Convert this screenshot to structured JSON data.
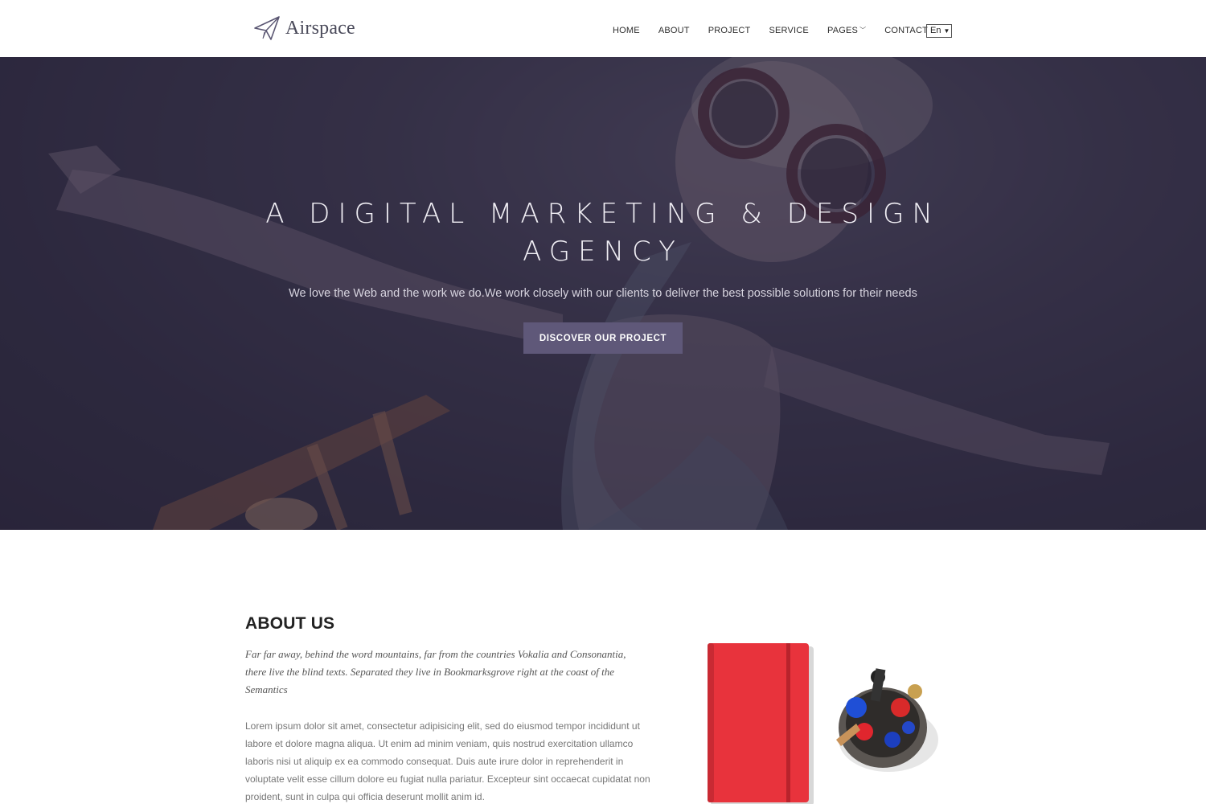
{
  "brand": {
    "name": "Airspace",
    "logo_icon": "paper-plane-icon"
  },
  "nav": {
    "items": [
      "HOME",
      "ABOUT",
      "PROJECT",
      "SERVICE",
      "PAGES",
      "CONTACT"
    ],
    "language": "En"
  },
  "hero": {
    "title_line1": "A DIGITAL MARKETING & DESIGN",
    "title_line2": "AGENCY",
    "subtitle": "We love the Web and the work we do.We work closely with our clients to deliver the best possible solutions for their needs",
    "cta": "DISCOVER OUR PROJECT"
  },
  "about": {
    "title": "ABOUT US",
    "quote": "Far far away, behind the word mountains, far from the countries Vokalia and Consonantia, there live the blind texts. Separated they live in Bookmarksgrove right at the coast of the Semantics",
    "body": "Lorem ipsum dolor sit amet, consectetur adipisicing elit, sed do eiusmod tempor incididunt ut labore et dolore magna aliqua. Ut enim ad minim veniam, quis nostrud exercitation ullamco laboris nisi ut aliquip ex ea commodo consequat. Duis aute irure dolor in reprehenderit in voluptate velit esse cillum dolore eu fugiat nulla pariatur. Excepteur sint occaecat cupidatat non proident, sunt in culpa qui officia deserunt mollit anim id."
  },
  "colors": {
    "accent": "#5f5879",
    "hero_overlay": "#2c2642",
    "notebook_red": "#e8333c"
  }
}
